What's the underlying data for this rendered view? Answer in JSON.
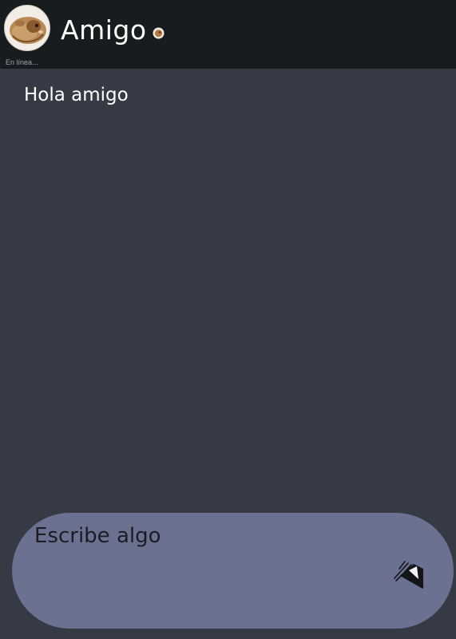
{
  "header": {
    "contact_name": "Amigo",
    "status_text": "En línea..."
  },
  "icons": {
    "avatar": "hamster-avatar-icon",
    "status": "online-status-icon",
    "send": "send-icon"
  },
  "messages": [
    {
      "text": "Hola amigo"
    }
  ],
  "composer": {
    "placeholder": "Escribe algo",
    "value": ""
  },
  "colors": {
    "header_bg": "#171d1f",
    "chat_bg": "#363a45",
    "composer_bg": "#6b7190"
  }
}
